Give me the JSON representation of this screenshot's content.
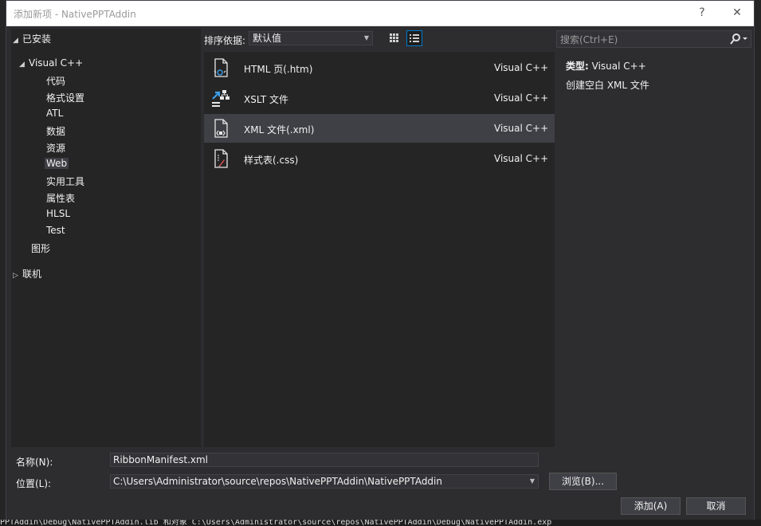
{
  "window": {
    "title": "添加新项 - NativePPTAddin",
    "help_symbol": "?",
    "close_symbol": "✕"
  },
  "background": {
    "bottom_log": "PPTAddin\\Debug\\NativePPTAddin.lib 和对象 C:\\Users\\Administrator\\source\\repos\\NativePPTAddin\\Debug\\NativePPTAddin.exp"
  },
  "tree": {
    "installed": "已安装",
    "visual_cpp": "Visual C++",
    "children": [
      "代码",
      "格式设置",
      "ATL",
      "数据",
      "资源",
      "Web",
      "实用工具",
      "属性表",
      "HLSL",
      "Test"
    ],
    "graphics": "图形",
    "online": "联机",
    "selected_child": "Web"
  },
  "sort": {
    "label": "排序依据:",
    "value": "默认值"
  },
  "search": {
    "placeholder": "搜索(Ctrl+E)"
  },
  "templates": [
    {
      "name": "HTML 页(.htm)",
      "lang": "Visual C++",
      "icon": "html-file-icon"
    },
    {
      "name": "XSLT 文件",
      "lang": "Visual C++",
      "icon": "xslt-file-icon"
    },
    {
      "name": "XML 文件(.xml)",
      "lang": "Visual C++",
      "icon": "xml-file-icon"
    },
    {
      "name": "样式表(.css)",
      "lang": "Visual C++",
      "icon": "css-file-icon"
    }
  ],
  "details": {
    "type_label": "类型:",
    "type_value": "Visual C++",
    "description": "创建空白 XML 文件"
  },
  "form": {
    "name_label": "名称(N):",
    "name_value": "RibbonManifest.xml",
    "location_label": "位置(L):",
    "location_value": "C:\\Users\\Administrator\\source\\repos\\NativePPTAddin\\NativePPTAddin",
    "browse": "浏览(B)...",
    "add": "添加(A)",
    "cancel": "取消"
  },
  "colors": {
    "accent": "#007acc",
    "panel": "#252526",
    "dialog": "#2d2d30",
    "selected_row": "#3f3f46"
  }
}
